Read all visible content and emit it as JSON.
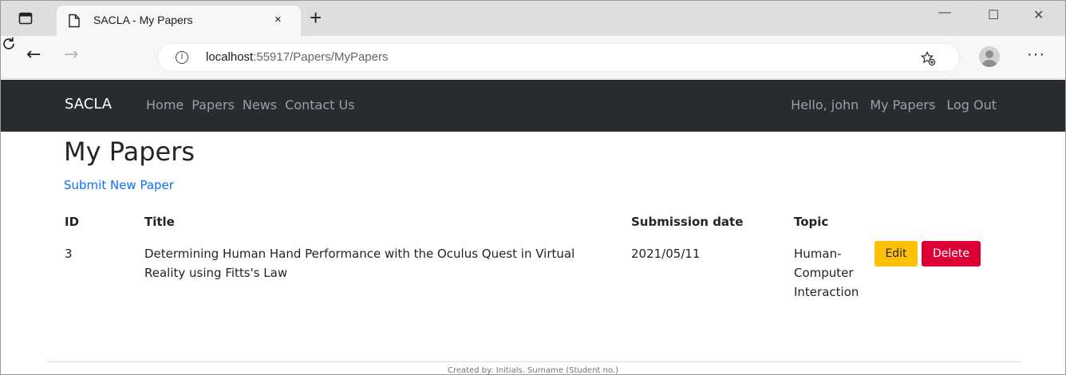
{
  "browser": {
    "tab_title": "SACLA - My Papers",
    "tab_close": "×",
    "new_tab": "+",
    "window_controls": {
      "minimize": "—",
      "maximize": "☐",
      "close": "✕"
    },
    "nav": {
      "back": "←",
      "forward": "→"
    },
    "url_host": "localhost",
    "url_path": ":55917/Papers/MyPapers",
    "info_glyph": "i",
    "more_glyph": "···"
  },
  "site_nav": {
    "brand": "SACLA",
    "links": [
      "Home",
      "Papers",
      "News",
      "Contact Us"
    ],
    "right_links": [
      "Hello, john",
      "My Papers",
      "Log Out"
    ]
  },
  "page": {
    "title": "My Papers",
    "submit_link": "Submit New Paper"
  },
  "table": {
    "headers": [
      "ID",
      "Title",
      "Submission date",
      "Topic"
    ],
    "rows": [
      {
        "id": "3",
        "title": "Determining Human Hand Performance with the Oculus Quest in Virtual Reality using Fitts's Law",
        "submission_date": "2021/05/11",
        "topic": "Human-Computer Interaction",
        "edit_label": "Edit",
        "delete_label": "Delete"
      }
    ]
  },
  "footer": {
    "text": "Created by: Initials. Surname (Student no.)"
  },
  "colors": {
    "navbar_bg": "#282c31",
    "link": "#0d6efd",
    "edit_btn": "#ffc107",
    "delete_btn": "#dc0035"
  },
  "icons": {
    "window": "window-icon",
    "favicon": "page-icon",
    "reload": "reload-icon",
    "info": "info-icon",
    "favorites": "favorites-add-icon",
    "profile": "profile-avatar-icon",
    "more": "more-options-icon"
  }
}
